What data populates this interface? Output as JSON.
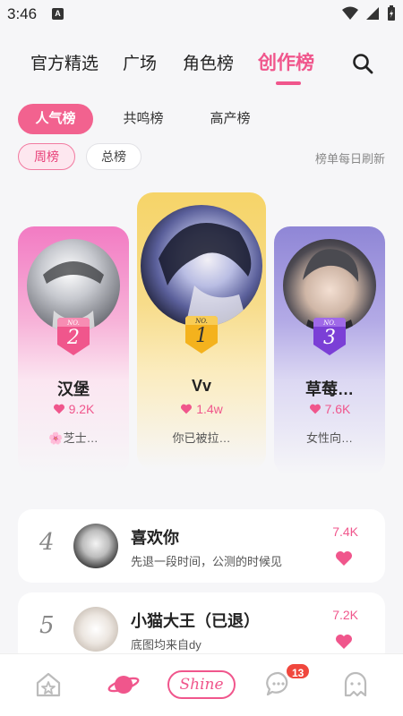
{
  "status": {
    "time": "3:46"
  },
  "top_tabs": [
    "官方精选",
    "广场",
    "角色榜",
    "创作榜"
  ],
  "categories": [
    "人气榜",
    "共鸣榜",
    "高产榜"
  ],
  "periods": [
    "周榜",
    "总榜"
  ],
  "refresh_note": "榜单每日刷新",
  "podium": [
    {
      "badge_text": "NO.",
      "rank": "2",
      "name": "汉堡",
      "likes": "9.2K",
      "desc": "🌸芝士…"
    },
    {
      "badge_text": "NO.",
      "rank": "1",
      "name": "Vv",
      "likes": "1.4w",
      "desc": "你已被拉…"
    },
    {
      "badge_text": "NO.",
      "rank": "3",
      "name": "草莓…",
      "likes": "7.6K",
      "desc": "女性向…"
    }
  ],
  "list": [
    {
      "rank": "4",
      "name": "喜欢你",
      "desc": "先退一段时间，公测的时候见",
      "likes": "7.4K"
    },
    {
      "rank": "5",
      "name": "小猫大王（已退）",
      "desc": "底图均来自dy",
      "likes": "7.2K"
    }
  ],
  "bottom_nav": {
    "shine_label": "Shine",
    "unread_count": "13"
  },
  "colors": {
    "accent": "#f0568c",
    "gold": "#f6d477",
    "purple": "#9a8ee0"
  }
}
